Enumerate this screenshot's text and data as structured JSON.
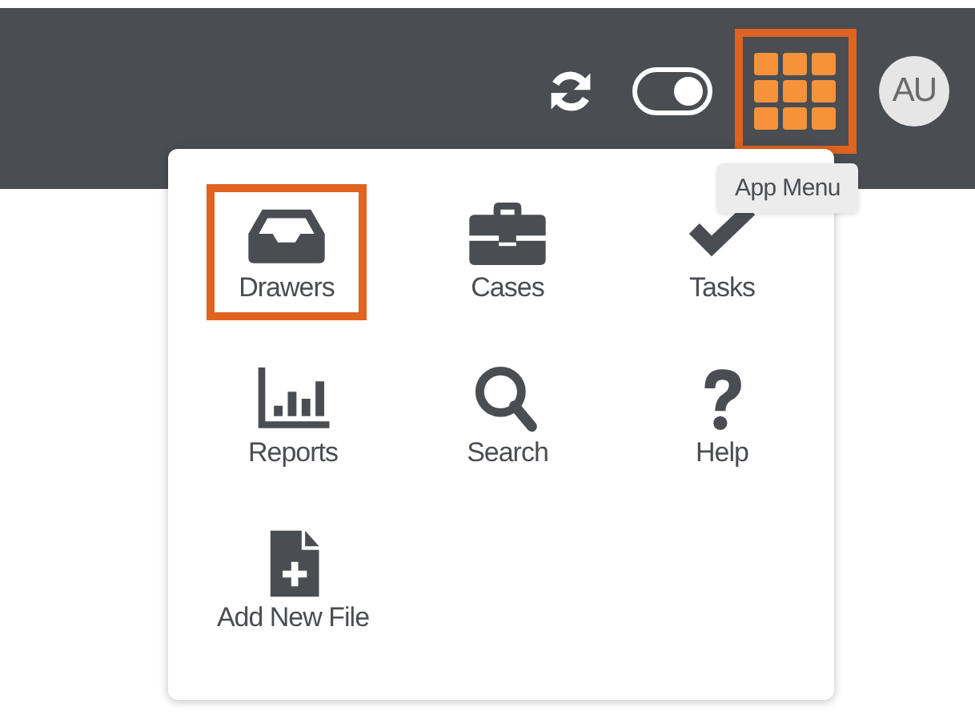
{
  "header": {
    "sync_on": true,
    "toggle": {
      "on": true
    },
    "app_menu": {
      "highlighted": true,
      "tooltip": "App Menu"
    },
    "avatar": "AU"
  },
  "app_menu": {
    "items": [
      {
        "label": "Drawers",
        "highlighted": true
      },
      {
        "label": "Cases",
        "highlighted": false
      },
      {
        "label": "Tasks",
        "highlighted": false
      },
      {
        "label": "Reports",
        "highlighted": false
      },
      {
        "label": "Search",
        "highlighted": false
      },
      {
        "label": "Help",
        "highlighted": false
      },
      {
        "label": "Add New File",
        "highlighted": false
      }
    ]
  }
}
